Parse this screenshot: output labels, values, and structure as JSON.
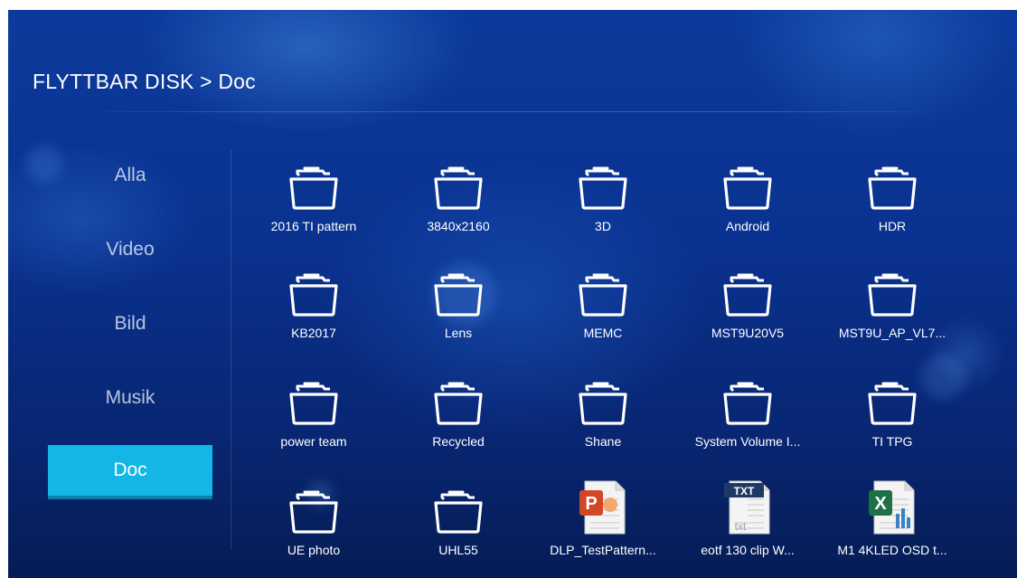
{
  "breadcrumb": "FLYTTBAR DISK > Doc",
  "sidebar": {
    "items": [
      {
        "label": "Alla",
        "active": false
      },
      {
        "label": "Video",
        "active": false
      },
      {
        "label": "Bild",
        "active": false
      },
      {
        "label": "Musik",
        "active": false
      },
      {
        "label": "Doc",
        "active": true
      }
    ]
  },
  "files": [
    {
      "name": "2016 TI pattern",
      "type": "folder"
    },
    {
      "name": "3840x2160",
      "type": "folder"
    },
    {
      "name": "3D",
      "type": "folder"
    },
    {
      "name": "Android",
      "type": "folder"
    },
    {
      "name": "HDR",
      "type": "folder"
    },
    {
      "name": "KB2017",
      "type": "folder"
    },
    {
      "name": "Lens",
      "type": "folder"
    },
    {
      "name": "MEMC",
      "type": "folder"
    },
    {
      "name": "MST9U20V5",
      "type": "folder"
    },
    {
      "name": "MST9U_AP_VL7...",
      "type": "folder"
    },
    {
      "name": "power team",
      "type": "folder"
    },
    {
      "name": "Recycled",
      "type": "folder"
    },
    {
      "name": "Shane",
      "type": "folder"
    },
    {
      "name": "System Volume I...",
      "type": "folder"
    },
    {
      "name": "TI TPG",
      "type": "folder"
    },
    {
      "name": "UE photo",
      "type": "folder"
    },
    {
      "name": "UHL55",
      "type": "folder"
    },
    {
      "name": "DLP_TestPattern...",
      "type": "powerpoint",
      "badge": "P"
    },
    {
      "name": "eotf 130 clip W...",
      "type": "txt",
      "badge": "TXT",
      "badge_sub": "txt"
    },
    {
      "name": "M1 4KLED OSD t...",
      "type": "excel",
      "badge": "X"
    }
  ],
  "colors": {
    "active_tab": "#13b6e6",
    "ppt_orange": "#d24726",
    "excel_green": "#1e7145",
    "txt_navy": "#1d3a66"
  }
}
